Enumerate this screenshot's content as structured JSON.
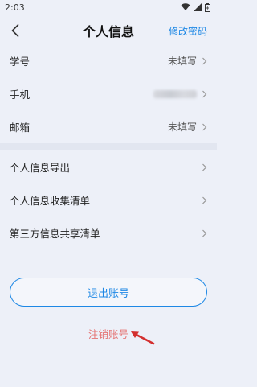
{
  "status": {
    "time": "2:03"
  },
  "header": {
    "title": "个人信息",
    "edit_password": "修改密码"
  },
  "info": [
    {
      "label": "学号",
      "value": "未填写"
    },
    {
      "label": "手机",
      "value": ""
    },
    {
      "label": "邮箱",
      "value": "未填写"
    }
  ],
  "links": [
    {
      "label": "个人信息导出"
    },
    {
      "label": "个人信息收集清单"
    },
    {
      "label": "第三方信息共享清单"
    }
  ],
  "actions": {
    "logout": "退出账号",
    "cancel_account": "注销账号"
  },
  "colors": {
    "accent": "#1e88e5",
    "danger": "#e57373",
    "background": "#edf0f8"
  }
}
